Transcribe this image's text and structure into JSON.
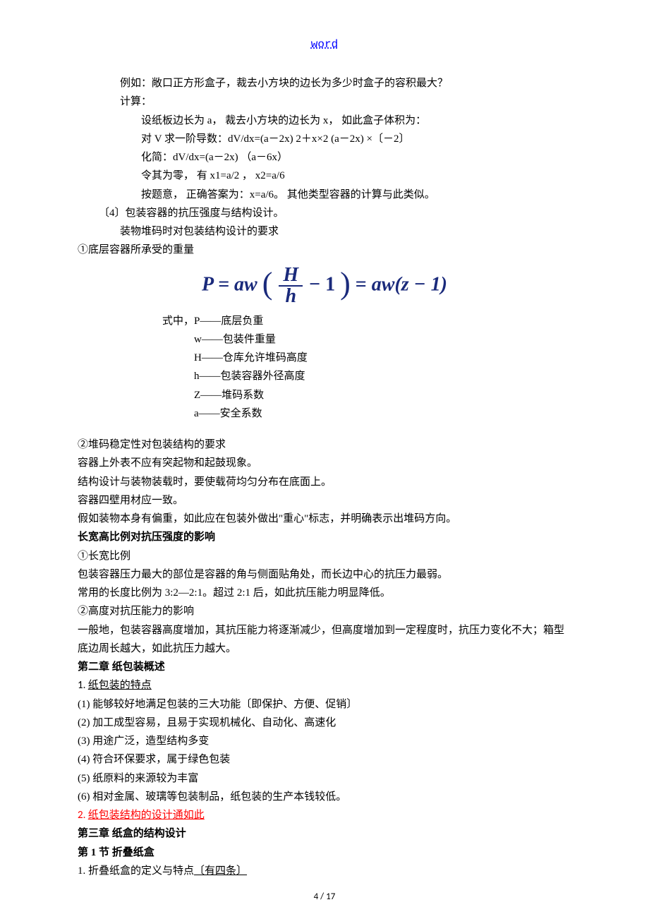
{
  "header": {
    "word": "word"
  },
  "body": {
    "l1": "例如：敞口正方形盒子，裁去小方块的边长为多少时盒子的容积最大？",
    "l2": "计算：",
    "l3": "设纸板边长为 a， 裁去小方块的边长为 x， 如此盒子体积为：",
    "l4": "对 V 求一阶导数：dV/dx=(a－2x) 2＋x×2 (a－2x) ×〔－2〕",
    "l5": "化简：dV/dx=(a－2x) （a－6x）",
    "l6": "令其为零， 有 x1=a/2 ， x2=a/6",
    "l7": "按题意， 正确答案为：x=a/6。  其他类型容器的计算与此类似。",
    "l8": "〔4〕包装容器的抗压强度与结构设计。",
    "l9": "装物堆码时对包装结构设计的要求",
    "l10": "①底层容器所承受的重量",
    "formula": {
      "left": "P = aw",
      "H": "H",
      "h": "h",
      "minus1a": " − 1",
      "eq": " = ",
      "right": "aw(z − 1)"
    },
    "def1": "式中，P——底层负重",
    "def2": "w——包装件重量",
    "def3": "H——仓库允许堆码高度",
    "def4": "h——包装容器外径高度",
    "def5": "Z——堆码系数",
    "def6": "a——安全系数",
    "l11": "②堆码稳定性对包装结构的要求",
    "l12": "容器上外表不应有突起物和起鼓现象。",
    "l13": "结构设计与装物装载时，要使载荷均匀分布在底面上。",
    "l14": "容器四壁用材应一致。",
    "l15": "假如装物本身有偏重，如此应在包装外做出\"重心\"标志，并明确表示出堆码方向。",
    "h1": "长宽高比例对抗压强度的影响",
    "l16": "①长宽比例",
    "l17": "包装容器压力最大的部位是容器的角与侧面贴角处，而长边中心的抗压力最弱。",
    "l18": "常用的长度比例为 3:2—2:1。超过 2:1 后，如此抗压能力明显降低。",
    "l19": "②高度对抗压能力的影响",
    "l20": "一般地，包装容器高度增加，其抗压能力将逐渐减少，但高度增加到一定程度时，抗压力变化不大；箱型底边周长越大，如此抗压力越大。",
    "h2": "第二章   纸包装概述",
    "item1pre": "1.   ",
    "item1": "纸包装的特点",
    "p1": "(1) 能够较好地满足包装的三大功能〔即保护、方便、促销〕",
    "p2": "(2) 加工成型容易，且易于实现机械化、自动化、高速化",
    "p3": "(3) 用途广泛，造型结构多变",
    "p4": "(4) 符合环保要求，属于绿色包装",
    "p5": "(5) 纸原料的来源较为丰富",
    "p6": "(6) 相对金属、玻璃等包装制品，纸包装的生产本钱较低。",
    "item2pre": "2.   ",
    "item2": "纸包装结构的设计通如此",
    "h3": "第三章  纸盒的结构设计",
    "h4": "第 1 节  折叠纸盒",
    "l21a": "1.   折叠纸盒的定义与特点",
    "l21b": "〔有四条〕"
  },
  "footer": {
    "page": "4 / 17"
  }
}
